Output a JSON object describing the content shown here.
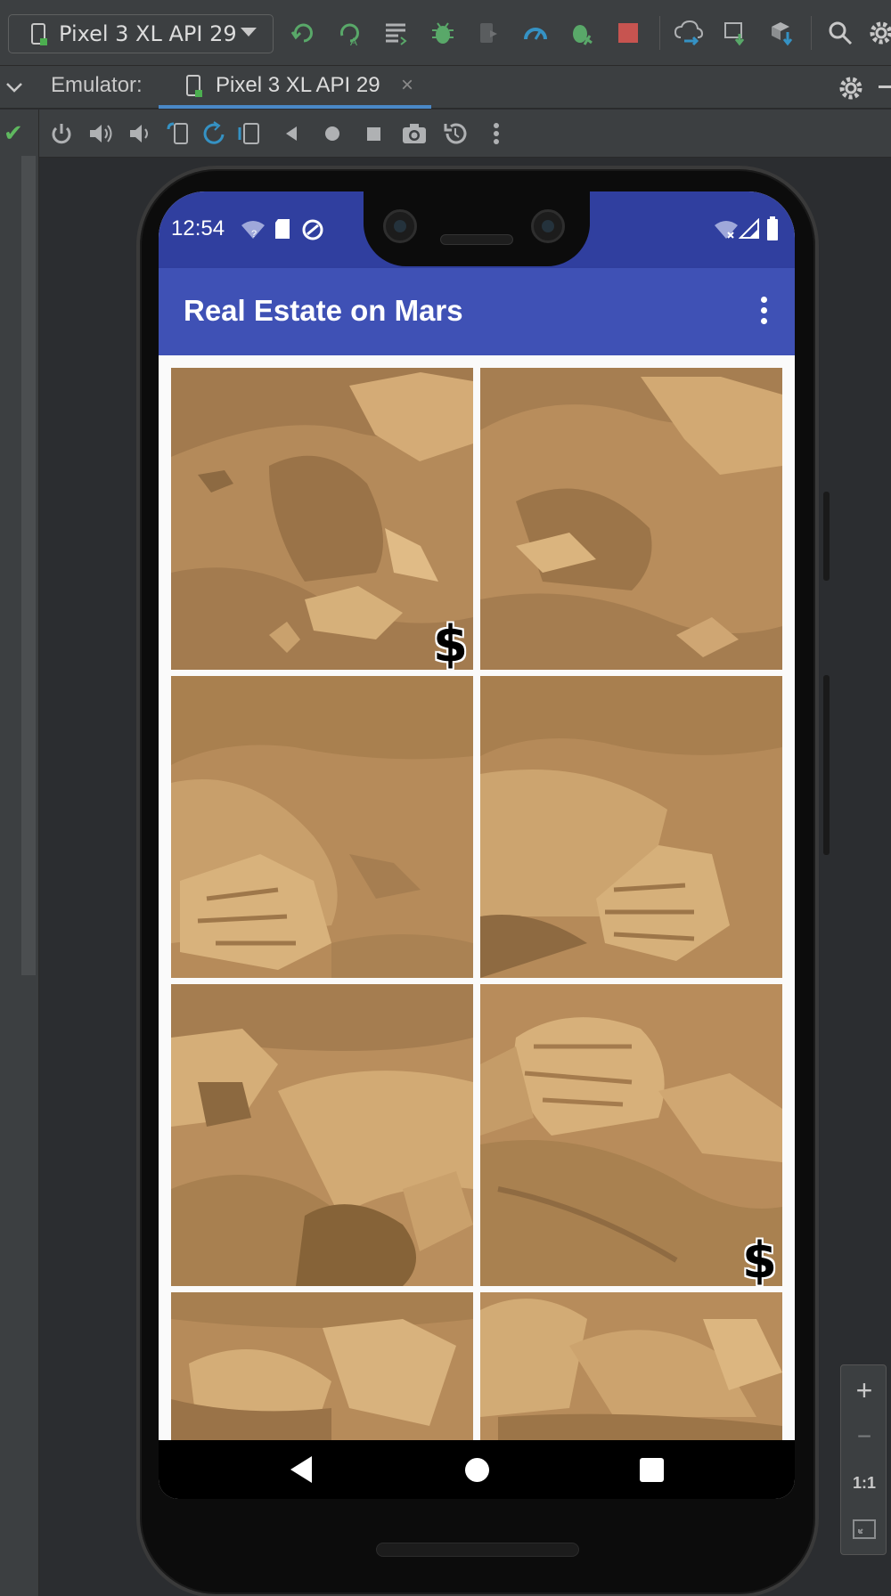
{
  "ide": {
    "device_select": "Pixel 3 XL API 29",
    "toolbar_icons": [
      "apply-changes-icon",
      "apply-code-changes-icon",
      "profile-icon",
      "debug-icon",
      "attach-debugger-icon",
      "profiler-icon",
      "build-variant-icon",
      "stop-icon",
      "sync-icon",
      "device-manager-icon",
      "sdk-manager-icon",
      "search-icon",
      "settings-icon"
    ]
  },
  "emulator": {
    "label": "Emulator:",
    "tab_label": "Pixel 3 XL API 29",
    "close_glyph": "×",
    "controls": [
      "power-icon",
      "volume-up-icon",
      "volume-down-icon",
      "rotate-left-icon",
      "rotate-right-icon",
      "fold-icon",
      "back-icon",
      "home-icon",
      "overview-icon",
      "screenshot-icon",
      "snapshot-icon",
      "more-icon"
    ]
  },
  "phone": {
    "status": {
      "time": "12:54"
    },
    "app_title": "Real Estate on Mars",
    "tiles": [
      {
        "for_sale": true,
        "symbol": "$"
      },
      {
        "for_sale": false,
        "symbol": ""
      },
      {
        "for_sale": false,
        "symbol": ""
      },
      {
        "for_sale": false,
        "symbol": ""
      },
      {
        "for_sale": false,
        "symbol": ""
      },
      {
        "for_sale": true,
        "symbol": "$"
      },
      {
        "for_sale": false,
        "symbol": ""
      },
      {
        "for_sale": false,
        "symbol": ""
      }
    ]
  },
  "zoom": {
    "plus": "+",
    "minus": "−",
    "actual": "1:1"
  },
  "colors": {
    "status_bar": "#303f9f",
    "app_bar": "#3f51b5",
    "mars_sand": "#b98d5c"
  }
}
